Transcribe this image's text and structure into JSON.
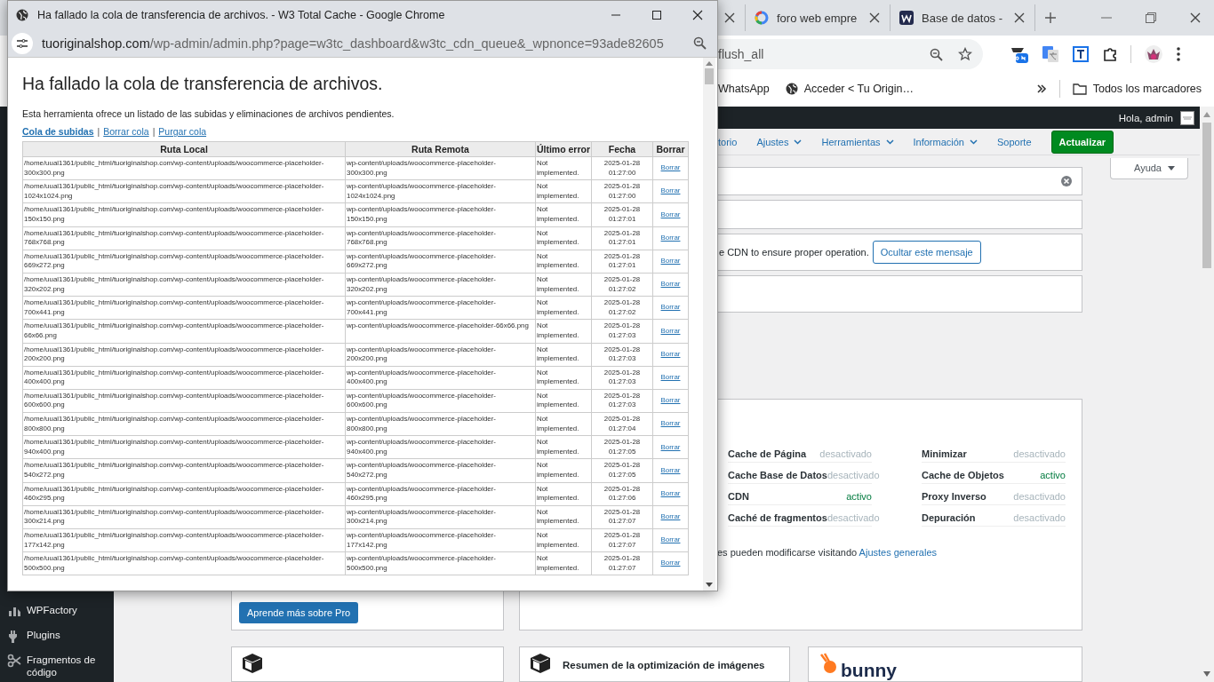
{
  "browser": {
    "tabs": [
      {
        "selected": false
      },
      {
        "label": "foro web empre",
        "kind": "google",
        "selected": false
      },
      {
        "label": "Base de datos -",
        "kind": "w",
        "selected": false
      }
    ],
    "address": "flush_all",
    "bookmarks": [
      "WhatsApp",
      "Acceder < Tu Origin…"
    ],
    "all_bookmarks": "Todos los marcadores"
  },
  "admin_bar": {
    "greeting": "Hola, admin"
  },
  "nav": [
    {
      "label": "torio",
      "has_menu": false
    },
    {
      "label": "Ajustes",
      "has_menu": true
    },
    {
      "label": "Herramientas",
      "has_menu": true
    },
    {
      "label": "Información",
      "has_menu": true
    },
    {
      "label": "Soporte",
      "has_menu": false
    }
  ],
  "update_button": "Actualizar",
  "help_button": "Ayuda",
  "notices": [
    {
      "kind": "dismissible"
    },
    {
      "kind": "empty"
    },
    {
      "kind": "message",
      "text": "e CDN to ensure proper operation.",
      "button": "Ocultar este mensaje"
    },
    {
      "kind": "empty"
    }
  ],
  "settings_columns": [
    [
      {
        "label": "Cache de Página",
        "value": "desactivado",
        "active": false
      },
      {
        "label": "Cache Base de Datos",
        "value": "desactivado",
        "active": false
      },
      {
        "label": "CDN",
        "value": "activo",
        "active": true
      },
      {
        "label": "Caché de fragmentos",
        "value": "desactivado",
        "active": false
      }
    ],
    [
      {
        "label": "Minimizar",
        "value": "desactivado",
        "active": false
      },
      {
        "label": "Cache de Objetos",
        "value": "activo",
        "active": true
      },
      {
        "label": "Proxy Inverso",
        "value": "desactivado",
        "active": false
      },
      {
        "label": "Depuración",
        "value": "desactivado",
        "active": false
      }
    ]
  ],
  "settings_note": {
    "text": "es pueden modificarse visitando ",
    "link": "Ajustes generales"
  },
  "pro_button": "Aprende más sobre Pro",
  "sidebar": [
    "WPFactory",
    "Plugins",
    "Fragmentos de código"
  ],
  "cards": [
    {
      "kind": "w3"
    },
    {
      "kind": "w3",
      "title": "Resumen de la optimización de imágenes"
    },
    {
      "kind": "bunny",
      "logo_text": "bunny"
    }
  ],
  "popup": {
    "title": "Ha fallado la cola de transferencia de archivos. - W3 Total Cache - Google Chrome",
    "url_domain": "tuoriginalshop.com",
    "url_path": "/wp-admin/admin.php?page=w3tc_dashboard&w3tc_cdn_queue&_wpnonce=93ade82605",
    "heading": "Ha fallado la cola de transferencia de archivos.",
    "description": "Esta herramienta ofrece un listado de las subidas y eliminaciones de archivos pendientes.",
    "links": [
      {
        "label": "Cola de subidas",
        "selected": true
      },
      {
        "label": "Borrar cola",
        "selected": false
      },
      {
        "label": "Purgar cola",
        "selected": false
      }
    ],
    "link_separators": [
      "|",
      "|"
    ],
    "table": {
      "columns": [
        "Ruta Local",
        "Ruta Remota",
        "Último error",
        "Fecha",
        "Borrar"
      ],
      "rows": [
        {
          "local": "/home/uual1361/public_html/tuoriginalshop.com/wp-content/uploads/woocommerce-placeholder-300x300.png",
          "remote": "wp-content/uploads/woocommerce-placeholder-300x300.png",
          "error": "Not implemented.",
          "date": "2025-01-28 01:27:00",
          "action": "Borrar"
        },
        {
          "local": "/home/uual1361/public_html/tuoriginalshop.com/wp-content/uploads/woocommerce-placeholder-1024x1024.png",
          "remote": "wp-content/uploads/woocommerce-placeholder-1024x1024.png",
          "error": "Not implemented.",
          "date": "2025-01-28 01:27:00",
          "action": "Borrar"
        },
        {
          "local": "/home/uual1361/public_html/tuoriginalshop.com/wp-content/uploads/woocommerce-placeholder-150x150.png",
          "remote": "wp-content/uploads/woocommerce-placeholder-150x150.png",
          "error": "Not implemented.",
          "date": "2025-01-28 01:27:01",
          "action": "Borrar"
        },
        {
          "local": "/home/uual1361/public_html/tuoriginalshop.com/wp-content/uploads/woocommerce-placeholder-768x768.png",
          "remote": "wp-content/uploads/woocommerce-placeholder-768x768.png",
          "error": "Not implemented.",
          "date": "2025-01-28 01:27:01",
          "action": "Borrar"
        },
        {
          "local": "/home/uual1361/public_html/tuoriginalshop.com/wp-content/uploads/woocommerce-placeholder-669x272.png",
          "remote": "wp-content/uploads/woocommerce-placeholder-669x272.png",
          "error": "Not implemented.",
          "date": "2025-01-28 01:27:01",
          "action": "Borrar"
        },
        {
          "local": "/home/uual1361/public_html/tuoriginalshop.com/wp-content/uploads/woocommerce-placeholder-320x202.png",
          "remote": "wp-content/uploads/woocommerce-placeholder-320x202.png",
          "error": "Not implemented.",
          "date": "2025-01-28 01:27:02",
          "action": "Borrar"
        },
        {
          "local": "/home/uual1361/public_html/tuoriginalshop.com/wp-content/uploads/woocommerce-placeholder-700x441.png",
          "remote": "wp-content/uploads/woocommerce-placeholder-700x441.png",
          "error": "Not implemented.",
          "date": "2025-01-28 01:27:02",
          "action": "Borrar"
        },
        {
          "local": "/home/uual1361/public_html/tuoriginalshop.com/wp-content/uploads/woocommerce-placeholder-66x66.png",
          "remote": "wp-content/uploads/woocommerce-placeholder-66x66.png",
          "error": "Not implemented.",
          "date": "2025-01-28 01:27:03",
          "action": "Borrar"
        },
        {
          "local": "/home/uual1361/public_html/tuoriginalshop.com/wp-content/uploads/woocommerce-placeholder-200x200.png",
          "remote": "wp-content/uploads/woocommerce-placeholder-200x200.png",
          "error": "Not implemented.",
          "date": "2025-01-28 01:27:03",
          "action": "Borrar"
        },
        {
          "local": "/home/uual1361/public_html/tuoriginalshop.com/wp-content/uploads/woocommerce-placeholder-400x400.png",
          "remote": "wp-content/uploads/woocommerce-placeholder-400x400.png",
          "error": "Not implemented.",
          "date": "2025-01-28 01:27:03",
          "action": "Borrar"
        },
        {
          "local": "/home/uual1361/public_html/tuoriginalshop.com/wp-content/uploads/woocommerce-placeholder-600x600.png",
          "remote": "wp-content/uploads/woocommerce-placeholder-600x600.png",
          "error": "Not implemented.",
          "date": "2025-01-28 01:27:03",
          "action": "Borrar"
        },
        {
          "local": "/home/uual1361/public_html/tuoriginalshop.com/wp-content/uploads/woocommerce-placeholder-800x800.png",
          "remote": "wp-content/uploads/woocommerce-placeholder-800x800.png",
          "error": "Not implemented.",
          "date": "2025-01-28 01:27:04",
          "action": "Borrar"
        },
        {
          "local": "/home/uual1361/public_html/tuoriginalshop.com/wp-content/uploads/woocommerce-placeholder-940x400.png",
          "remote": "wp-content/uploads/woocommerce-placeholder-940x400.png",
          "error": "Not implemented.",
          "date": "2025-01-28 01:27:05",
          "action": "Borrar"
        },
        {
          "local": "/home/uual1361/public_html/tuoriginalshop.com/wp-content/uploads/woocommerce-placeholder-540x272.png",
          "remote": "wp-content/uploads/woocommerce-placeholder-540x272.png",
          "error": "Not implemented.",
          "date": "2025-01-28 01:27:05",
          "action": "Borrar"
        },
        {
          "local": "/home/uual1361/public_html/tuoriginalshop.com/wp-content/uploads/woocommerce-placeholder-460x295.png",
          "remote": "wp-content/uploads/woocommerce-placeholder-460x295.png",
          "error": "Not implemented.",
          "date": "2025-01-28 01:27:06",
          "action": "Borrar"
        },
        {
          "local": "/home/uual1361/public_html/tuoriginalshop.com/wp-content/uploads/woocommerce-placeholder-300x214.png",
          "remote": "wp-content/uploads/woocommerce-placeholder-300x214.png",
          "error": "Not implemented.",
          "date": "2025-01-28 01:27:07",
          "action": "Borrar"
        },
        {
          "local": "/home/uual1361/public_html/tuoriginalshop.com/wp-content/uploads/woocommerce-placeholder-177x142.png",
          "remote": "wp-content/uploads/woocommerce-placeholder-177x142.png",
          "error": "Not implemented.",
          "date": "2025-01-28 01:27:07",
          "action": "Borrar"
        },
        {
          "local": "/home/uual1361/public_html/tuoriginalshop.com/wp-content/uploads/woocommerce-placeholder-500x500.png",
          "remote": "wp-content/uploads/woocommerce-placeholder-500x500.png",
          "error": "Not implemented.",
          "date": "2025-01-28 01:27:07",
          "action": "Borrar"
        }
      ]
    }
  }
}
